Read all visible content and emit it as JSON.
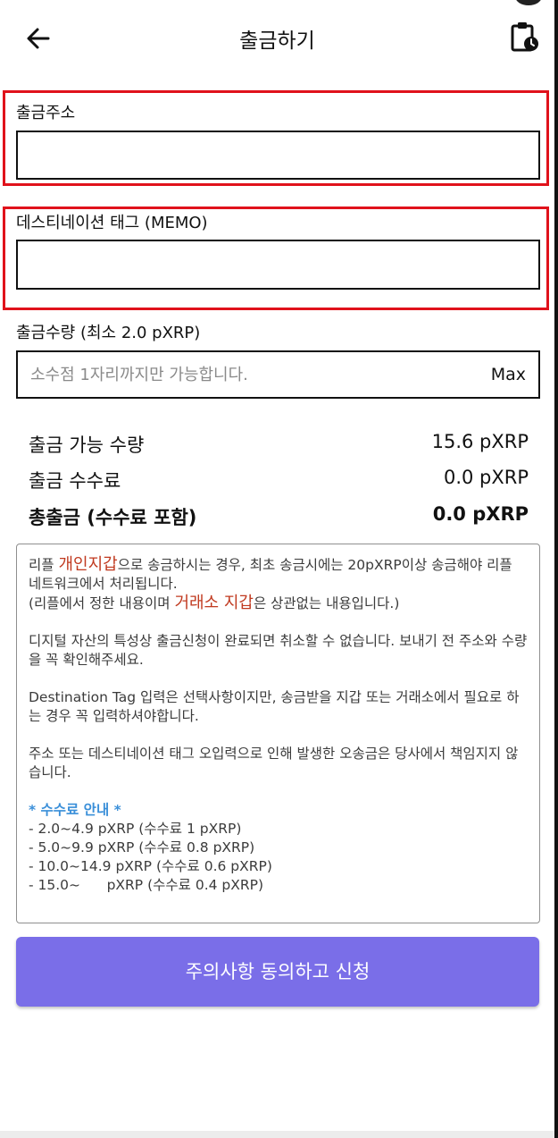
{
  "header": {
    "title": "출금하기",
    "back_icon": "arrow-left-icon",
    "history_icon": "clipboard-clock-icon"
  },
  "form": {
    "address_label": "출금주소",
    "address_value": "",
    "memo_label": "데스티네이션 태그 (MEMO)",
    "memo_value": "",
    "amount_label": "출금수량 (최소 2.0 pXRP)",
    "amount_placeholder": "소수점 1자리까지만 가능합니다.",
    "max_label": "Max"
  },
  "summary": [
    {
      "label": "출금 가능 수량",
      "value": "15.6 pXRP"
    },
    {
      "label": "출금 수수료",
      "value": "0.0 pXRP"
    },
    {
      "label": "총출금 (수수료 포함)",
      "value": "0.0 pXRP"
    }
  ],
  "notice": {
    "p1_a": "리플 ",
    "p1_em1": "개인지갑",
    "p1_b": "으로 송금하시는 경우, 최초 송금시에는 20pXRP이상 송금해야 리플 네트워크에서 처리됩니다.",
    "p1_c": "(리플에서 정한 내용이며 ",
    "p1_em2": "거래소 지갑",
    "p1_d": "은 상관없는 내용입니다.)",
    "p2": "디지털 자산의 특성상 출금신청이 완료되면 취소할 수 없습니다. 보내기 전 주소와 수량을 꼭 확인해주세요.",
    "p3": "Destination Tag 입력은 선택사항이지만, 송금받을 지갑 또는 거래소에서 필요로 하는 경우 꼭 입력하셔야합니다.",
    "p4": "주소 또는 데스티네이션 태그 오입력으로 인해 발생한 오송금은 당사에서 책임지지 않습니다.",
    "fee_title": "* 수수료 안내 *",
    "fees": [
      "- 2.0~4.9 pXRP (수수료 1 pXRP)",
      "- 5.0~9.9 pXRP (수수료 0.8 pXRP)",
      "- 10.0~14.9 pXRP (수수료 0.6 pXRP)",
      "- 15.0~      pXRP (수수료 0.4 pXRP)"
    ]
  },
  "submit_label": "주의사항 동의하고 신청",
  "colors": {
    "highlight": "#e0121b",
    "accent": "#7a6ee8",
    "emphasis": "#c0391f",
    "fee_title": "#3a8fd9"
  }
}
